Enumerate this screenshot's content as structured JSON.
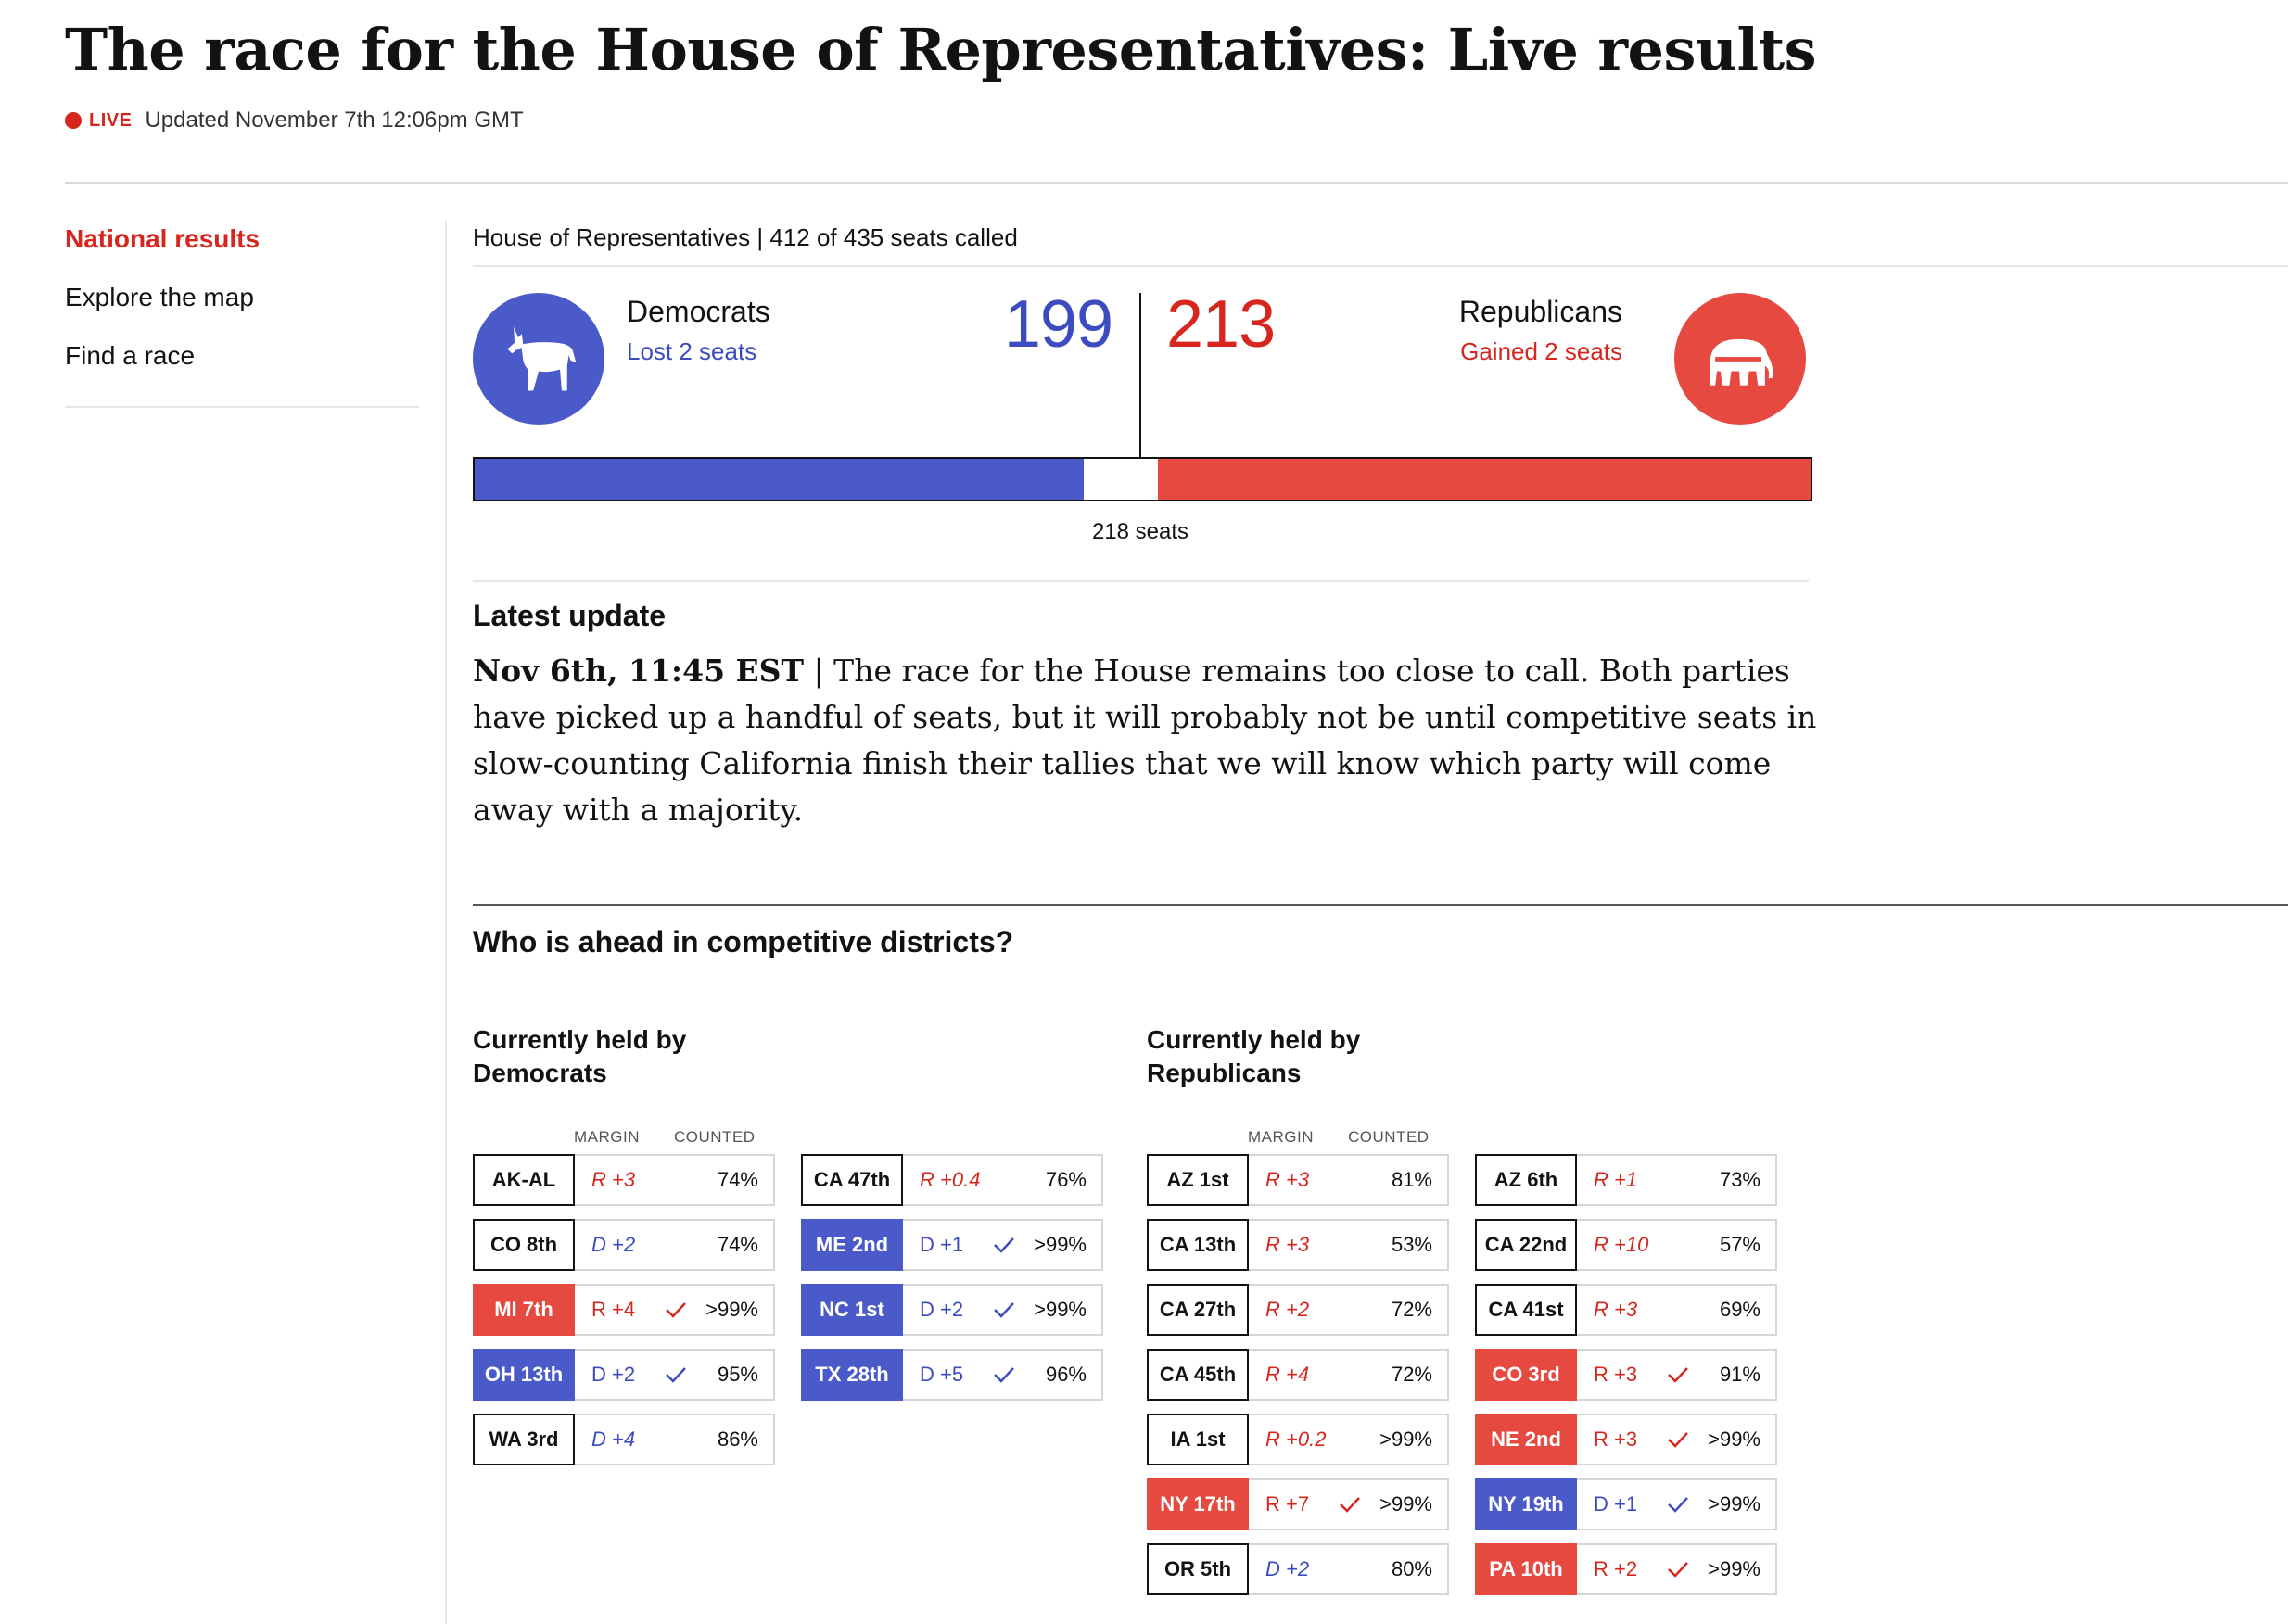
{
  "title": "The race for the House of Representatives: Live results",
  "live": {
    "label": "LIVE",
    "updated": "Updated November 7th 12:06pm GMT"
  },
  "nav": [
    {
      "label": "National results",
      "active": true
    },
    {
      "label": "Explore the map",
      "active": false
    },
    {
      "label": "Find a race",
      "active": false
    }
  ],
  "summary": {
    "called_text": "House of Representatives | 412 of 435 seats called",
    "total_seats": 435,
    "majority_label": "218 seats",
    "democrats": {
      "name": "Democrats",
      "change": "Lost 2 seats",
      "seats": "199",
      "color": "#4b5ac9",
      "icon": "donkey-icon"
    },
    "republicans": {
      "name": "Republicans",
      "change": "Gained 2 seats",
      "seats": "213",
      "color": "#e5493f",
      "icon": "elephant-icon"
    }
  },
  "latest_update": {
    "heading": "Latest update",
    "date": "Nov 6th, 11:45 EST",
    "text": "| The race for the House remains too close to call. Both parties have picked up a handful of seats, but it will probably not be until competitive seats in slow-counting California finish their tallies that we will know which party will come away with a majority."
  },
  "competitive": {
    "heading": "Who is ahead in competitive districts?",
    "col_margin": "MARGIN",
    "col_counted": "COUNTED",
    "groups": [
      {
        "title": "Currently held by Democrats",
        "columns": [
          [
            {
              "district": "AK-AL",
              "margin": "R +3",
              "counted": "74%",
              "winner": ""
            },
            {
              "district": "CO 8th",
              "margin": "D +2",
              "counted": "74%",
              "winner": ""
            },
            {
              "district": "MI 7th",
              "margin": "R +4",
              "counted": ">99%",
              "winner": "R"
            },
            {
              "district": "OH 13th",
              "margin": "D +2",
              "counted": "95%",
              "winner": "D"
            },
            {
              "district": "WA 3rd",
              "margin": "D +4",
              "counted": "86%",
              "winner": ""
            }
          ],
          [
            {
              "district": "CA 47th",
              "margin": "R +0.4",
              "counted": "76%",
              "winner": ""
            },
            {
              "district": "ME 2nd",
              "margin": "D +1",
              "counted": ">99%",
              "winner": "D"
            },
            {
              "district": "NC 1st",
              "margin": "D +2",
              "counted": ">99%",
              "winner": "D"
            },
            {
              "district": "TX 28th",
              "margin": "D +5",
              "counted": "96%",
              "winner": "D"
            }
          ]
        ]
      },
      {
        "title": "Currently held by Republicans",
        "columns": [
          [
            {
              "district": "AZ 1st",
              "margin": "R +3",
              "counted": "81%",
              "winner": ""
            },
            {
              "district": "CA 13th",
              "margin": "R +3",
              "counted": "53%",
              "winner": ""
            },
            {
              "district": "CA 27th",
              "margin": "R +2",
              "counted": "72%",
              "winner": ""
            },
            {
              "district": "CA 45th",
              "margin": "R +4",
              "counted": "72%",
              "winner": ""
            },
            {
              "district": "IA 1st",
              "margin": "R +0.2",
              "counted": ">99%",
              "winner": ""
            },
            {
              "district": "NY 17th",
              "margin": "R +7",
              "counted": ">99%",
              "winner": "R"
            },
            {
              "district": "OR 5th",
              "margin": "D +2",
              "counted": "80%",
              "winner": ""
            }
          ],
          [
            {
              "district": "AZ 6th",
              "margin": "R +1",
              "counted": "73%",
              "winner": ""
            },
            {
              "district": "CA 22nd",
              "margin": "R +10",
              "counted": "57%",
              "winner": ""
            },
            {
              "district": "CA 41st",
              "margin": "R +3",
              "counted": "69%",
              "winner": ""
            },
            {
              "district": "CO 3rd",
              "margin": "R +3",
              "counted": "91%",
              "winner": "R"
            },
            {
              "district": "NE 2nd",
              "margin": "R +3",
              "counted": ">99%",
              "winner": "R"
            },
            {
              "district": "NY 19th",
              "margin": "D +1",
              "counted": ">99%",
              "winner": "D"
            },
            {
              "district": "PA 10th",
              "margin": "R +2",
              "counted": ">99%",
              "winner": "R"
            }
          ]
        ]
      }
    ]
  }
}
